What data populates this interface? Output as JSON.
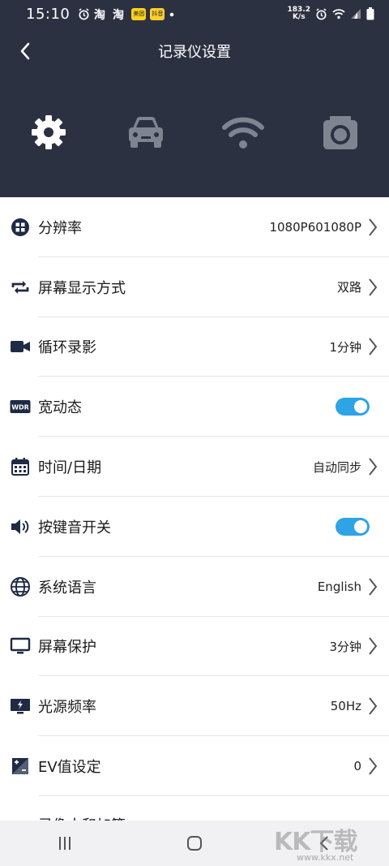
{
  "status_bar": {
    "time": "15:10",
    "badge1": "美团",
    "badge2": "抖音",
    "net_speed_value": "183.2",
    "net_speed_unit": "K/s",
    "icons": [
      "alarm-icon",
      "taobao-icon",
      "taobao-icon",
      "meituan-icon",
      "app-icon",
      "dot-icon",
      "alarm-icon",
      "wifi-icon",
      "signal-icon",
      "battery-icon"
    ]
  },
  "header": {
    "title": "记录仪设置",
    "tabs": [
      {
        "name": "settings",
        "icon": "gear-icon",
        "active": true
      },
      {
        "name": "car",
        "icon": "car-icon",
        "active": false
      },
      {
        "name": "wifi",
        "icon": "wifi-icon",
        "active": false
      },
      {
        "name": "camera",
        "icon": "camera-icon",
        "active": false
      }
    ],
    "colors": {
      "background": "#2c3142",
      "active_icon": "#ffffff",
      "inactive_icon": "#7f8491"
    }
  },
  "settings": [
    {
      "label": "分辨率",
      "value": "1080P601080P",
      "icon": "grid-icon",
      "type": "select"
    },
    {
      "label": "屏幕显示方式",
      "value": "双路",
      "icon": "repeat-icon",
      "type": "select"
    },
    {
      "label": "循环录影",
      "value": "1分钟",
      "icon": "video-icon",
      "type": "select"
    },
    {
      "label": "宽动态",
      "icon_text": "WDR",
      "icon": "wdr-icon",
      "type": "toggle",
      "on": true
    },
    {
      "label": "时间/日期",
      "value": "自动同步",
      "icon": "calendar-icon",
      "type": "select"
    },
    {
      "label": "按键音开关",
      "icon": "speaker-icon",
      "type": "toggle",
      "on": true
    },
    {
      "label": "系统语言",
      "value": "English",
      "icon": "globe-icon",
      "type": "select"
    },
    {
      "label": "屏幕保护",
      "value": "3分钟",
      "icon": "monitor-icon",
      "type": "select"
    },
    {
      "label": "光源频率",
      "value": "50Hz",
      "icon": "flicker-icon",
      "type": "select"
    },
    {
      "label": "EV值设定",
      "value": "0",
      "icon": "exposure-icon",
      "type": "select"
    }
  ],
  "partial_row": {
    "label": "录像木和加等"
  },
  "navbar": {
    "buttons": [
      "recents-icon",
      "home-icon",
      "back-icon"
    ]
  },
  "watermark": {
    "text": "KK下载",
    "url": "www.kkx.net"
  },
  "accent_color": "#2ea3e6"
}
